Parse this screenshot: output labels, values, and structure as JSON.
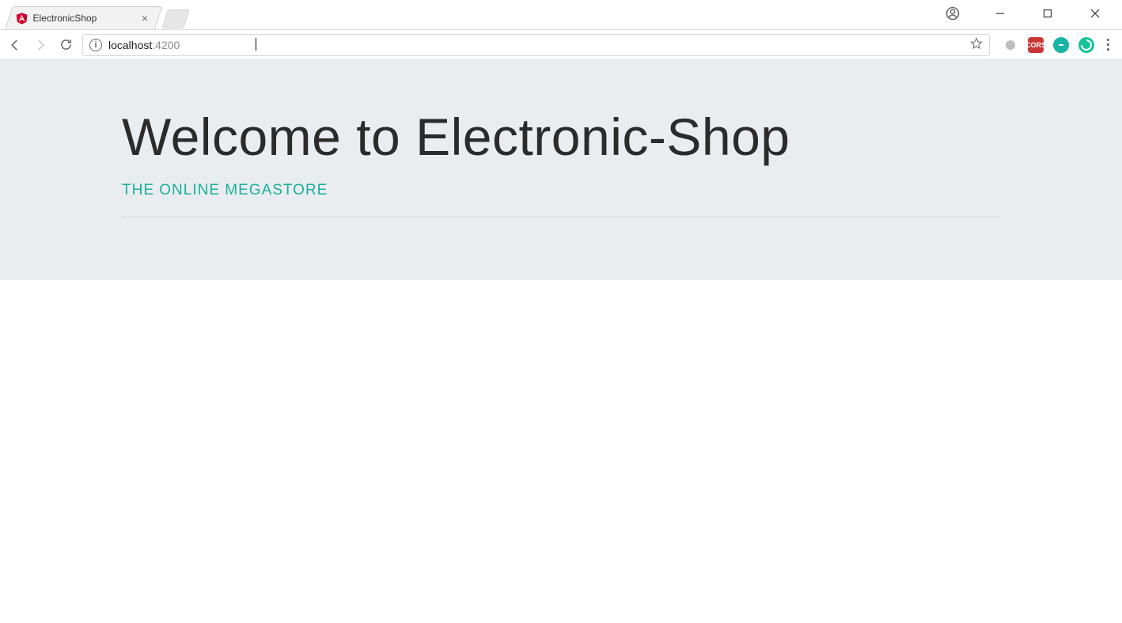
{
  "tab": {
    "title": "ElectronicShop",
    "favicon": "angular-icon"
  },
  "address": {
    "host": "localhost",
    "port": ":4200"
  },
  "extensions": {
    "cors_label": "CORS"
  },
  "page": {
    "heading": "Welcome to Electronic-Shop",
    "subtitle": "THE ONLINE MEGASTORE"
  }
}
